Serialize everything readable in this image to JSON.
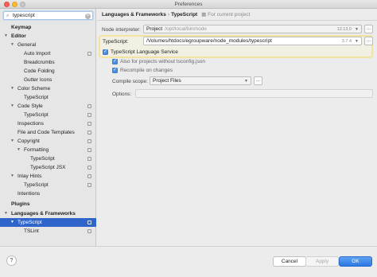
{
  "window": {
    "title": "Preferences"
  },
  "sidebar": {
    "search_value": "typescript",
    "items": [
      {
        "label": "Keymap"
      },
      {
        "label": "Editor"
      },
      {
        "label": "General"
      },
      {
        "label": "Auto Import"
      },
      {
        "label": "Breadcrumbs"
      },
      {
        "label": "Code Folding"
      },
      {
        "label": "Gutter Icons"
      },
      {
        "label": "Color Scheme"
      },
      {
        "label": "TypeScript"
      },
      {
        "label": "Code Style"
      },
      {
        "label": "TypeScript"
      },
      {
        "label": "Inspections"
      },
      {
        "label": "File and Code Templates"
      },
      {
        "label": "Copyright"
      },
      {
        "label": "Formatting"
      },
      {
        "label": "TypeScript"
      },
      {
        "label": "TypeScript JSX"
      },
      {
        "label": "Inlay Hints"
      },
      {
        "label": "TypeScript"
      },
      {
        "label": "Intentions"
      },
      {
        "label": "Plugins"
      },
      {
        "label": "Languages & Frameworks"
      },
      {
        "label": "TypeScript"
      },
      {
        "label": "TSLint"
      }
    ]
  },
  "breadcrumb": {
    "part1": "Languages & Frameworks",
    "separator": "›",
    "part2": "TypeScript",
    "scope": "For current project"
  },
  "settings": {
    "node_label": "Node interpreter:",
    "node_value": "Project",
    "node_path": "/opt/local/bin/node",
    "node_version": "12.13.0",
    "ts_label": "TypeScript:",
    "ts_value": "/Volumes/htdocs/egroupware/node_modules/typescript",
    "ts_version": "3.7.4",
    "service_label": "TypeScript Language Service",
    "also_label": "Also for projects without tsconfig.json",
    "recompile_label": "Recompile on changes",
    "scope_label": "Compile scope:",
    "scope_value": "Project Files",
    "options_label": "Options:",
    "options_value": "",
    "dots": "..."
  },
  "footer": {
    "help": "?",
    "cancel": "Cancel",
    "apply": "Apply",
    "ok": "OK"
  },
  "colors": {
    "selection": "#2f65ca",
    "highlight": "#f2e3a1",
    "ok_button": "#2c78e3"
  }
}
